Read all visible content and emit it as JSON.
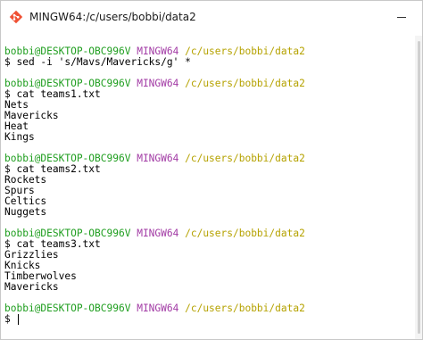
{
  "window": {
    "title": "MINGW64:/c/users/bobbi/data2"
  },
  "terminal": {
    "sessions": [
      {
        "user": "bobbi@DESKTOP-OBC996V",
        "mode": "MINGW64",
        "path": "/c/users/bobbi/data2",
        "command": "$ sed -i 's/Mavs/Mavericks/g' *",
        "output": []
      },
      {
        "user": "bobbi@DESKTOP-OBC996V",
        "mode": "MINGW64",
        "path": "/c/users/bobbi/data2",
        "command": "$ cat teams1.txt",
        "output": [
          "Nets",
          "Mavericks",
          "Heat",
          "Kings"
        ]
      },
      {
        "user": "bobbi@DESKTOP-OBC996V",
        "mode": "MINGW64",
        "path": "/c/users/bobbi/data2",
        "command": "$ cat teams2.txt",
        "output": [
          "Rockets",
          "Spurs",
          "Celtics",
          "Nuggets"
        ]
      },
      {
        "user": "bobbi@DESKTOP-OBC996V",
        "mode": "MINGW64",
        "path": "/c/users/bobbi/data2",
        "command": "$ cat teams3.txt",
        "output": [
          "Grizzlies",
          "Knicks",
          "Timberwolves",
          "Mavericks"
        ]
      },
      {
        "user": "bobbi@DESKTOP-OBC996V",
        "mode": "MINGW64",
        "path": "/c/users/bobbi/data2",
        "command": "$ ",
        "output": []
      }
    ]
  },
  "colors": {
    "user": "#1f9e1f",
    "mode": "#a23ba5",
    "path": "#b5a200"
  },
  "icons": {
    "app": "git-bash-icon",
    "minimize": "minimize-icon"
  }
}
